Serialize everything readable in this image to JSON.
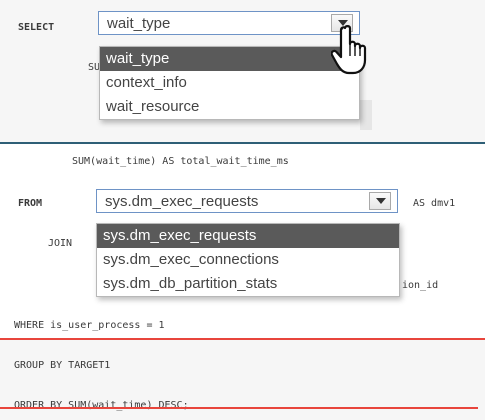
{
  "colors": {
    "teal_rule": "#2e5f76",
    "red_rule": "#e8453c",
    "combo_border": "#6e93c6",
    "selected_bg": "#5a5a5a"
  },
  "top": {
    "keyword": "SELECT",
    "combo_value": "wait_type",
    "hidden_fragment": "SU",
    "options": [
      "wait_type",
      "context_info",
      "wait_resource"
    ],
    "selected_index": 0
  },
  "bottom": {
    "sum_line": "SUM(wait_time) AS total_wait_time_ms",
    "from_keyword": "FROM",
    "combo_value": "sys.dm_exec_requests",
    "alias": "AS dmv1",
    "join_fragment": "JOIN",
    "join_tail": "ion_id",
    "options": [
      "sys.dm_exec_requests",
      "sys.dm_exec_connections",
      "sys.dm_db_partition_stats"
    ],
    "selected_index": 0,
    "where_line": "WHERE is_user_process = 1",
    "group_line": "GROUP BY TARGET1",
    "order_line": "ORDER BY SUM(wait_time) DESC;"
  },
  "icons": {
    "cursor": "hand-pointer-icon",
    "dropdown": "chevron-down-icon"
  }
}
